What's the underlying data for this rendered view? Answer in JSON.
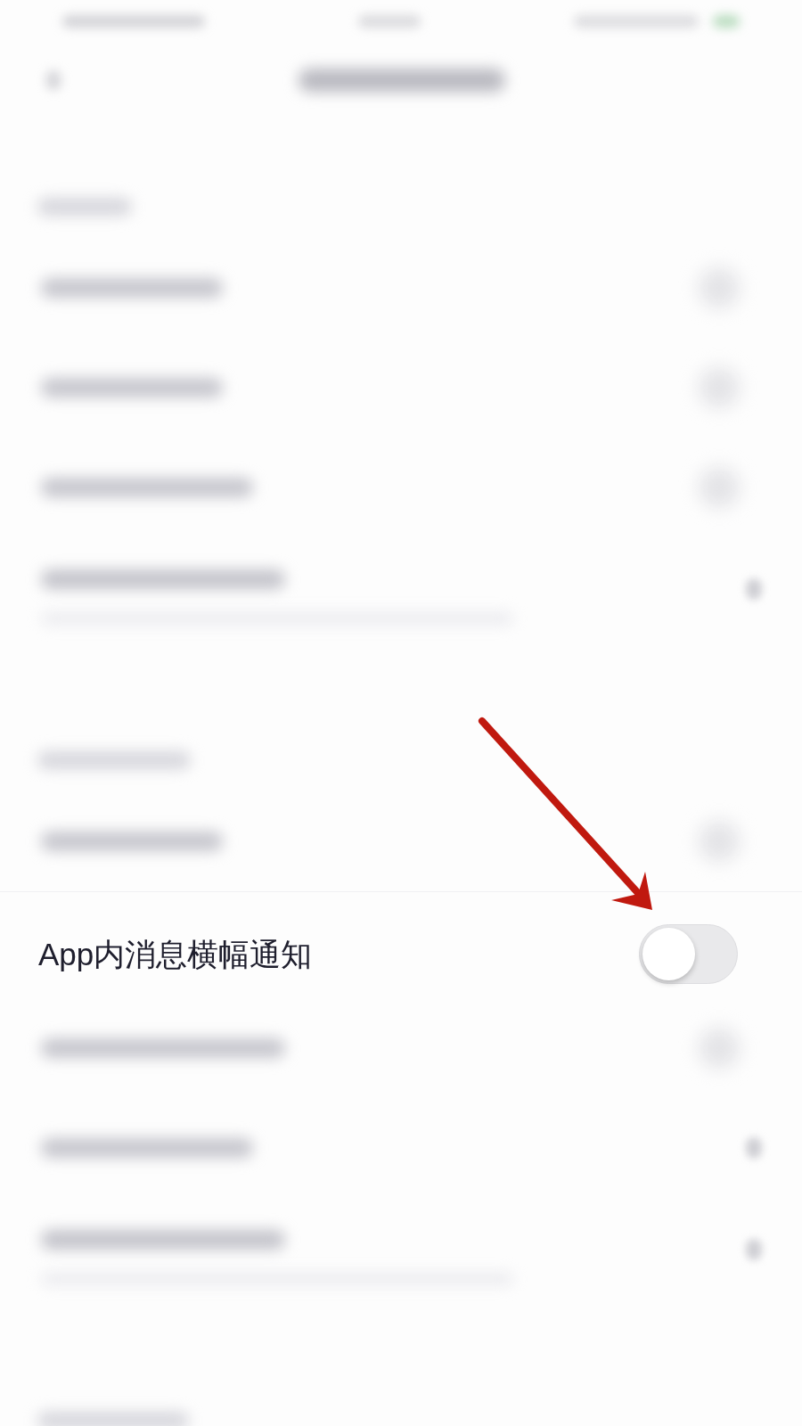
{
  "rows": [
    {
      "kind": "blurred_status_bar"
    },
    {
      "kind": "blurred_nav_bar"
    },
    {
      "kind": "blurred_header"
    },
    {
      "kind": "blurred_toggle"
    },
    {
      "kind": "blurred_toggle"
    },
    {
      "kind": "blurred_toggle"
    },
    {
      "kind": "blurred_subtitle_chevron"
    },
    {
      "kind": "blurred_header"
    },
    {
      "kind": "blurred_toggle"
    },
    {
      "kind": "toggle",
      "label": "App内消息横幅通知",
      "on": false
    },
    {
      "kind": "blurred_toggle"
    },
    {
      "kind": "blurred_chevron"
    },
    {
      "kind": "blurred_subtitle_chevron"
    },
    {
      "kind": "blurred_header"
    }
  ],
  "annotation": {
    "kind": "arrow"
  }
}
